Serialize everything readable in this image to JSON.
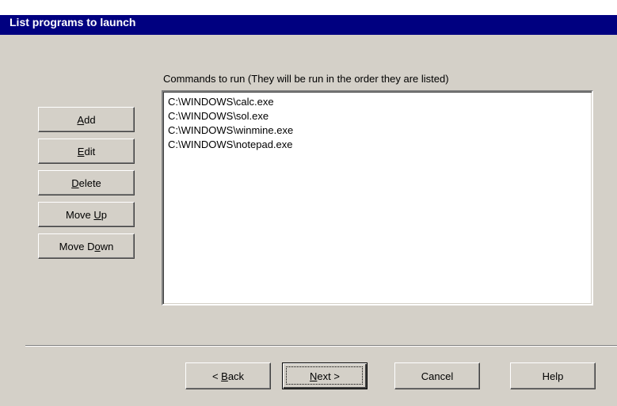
{
  "title": "List programs to launch",
  "commands_label": "Commands to run (They will be run in the order they are listed)",
  "commands": [
    "C:\\WINDOWS\\calc.exe",
    "C:\\WINDOWS\\sol.exe",
    "C:\\WINDOWS\\winmine.exe",
    "C:\\WINDOWS\\notepad.exe"
  ],
  "side_buttons": {
    "add": {
      "pre": "",
      "key": "A",
      "post": "dd"
    },
    "edit": {
      "pre": "",
      "key": "E",
      "post": "dit"
    },
    "delete": {
      "pre": "",
      "key": "D",
      "post": "elete"
    },
    "move_up": {
      "pre": "Move ",
      "key": "U",
      "post": "p"
    },
    "move_down": {
      "pre": "Move D",
      "key": "o",
      "post": "wn"
    }
  },
  "bottom_buttons": {
    "back": {
      "pre": "< ",
      "key": "B",
      "post": "ack"
    },
    "next": {
      "pre": "",
      "key": "N",
      "post": "ext >"
    },
    "cancel": "Cancel",
    "help": "Help"
  },
  "colors": {
    "title_bar": "#000080",
    "dialog_face": "#d4d0c8",
    "list_background": "#ffffff"
  }
}
